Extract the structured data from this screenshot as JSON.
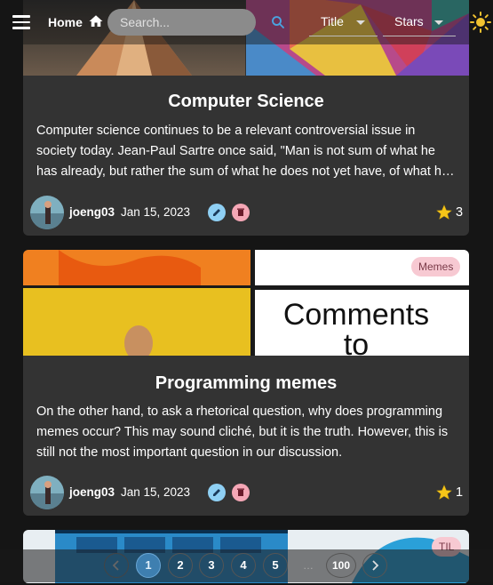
{
  "header": {
    "home_label": "Home",
    "search_placeholder": "Search...",
    "sort_select": "Title",
    "filter_select": "Stars"
  },
  "cards": [
    {
      "title": "Computer Science",
      "excerpt": "Computer science continues to be a relevant controversial issue in society today. Jean-Paul Sartre once said, \"Man is not sum of what he has already, but rather the sum of what he does not yet have, of what he could have.\"",
      "author": "joeng03",
      "date": "Jan 15, 2023",
      "stars": "3",
      "tag": ""
    },
    {
      "title": "Programming memes",
      "excerpt": "On the other hand, to ask a rhetorical question, why does programming memes occur? This may sound cliché, but it is the truth. However, this is still not the most important question in our discussion.",
      "author": "joeng03",
      "date": "Jan 15, 2023",
      "stars": "1",
      "tag": "Memes",
      "image_text_1": "Comments",
      "image_text_2": "to"
    },
    {
      "tag": "TIL"
    }
  ],
  "pagination": {
    "pages": [
      "1",
      "2",
      "3",
      "4",
      "5"
    ],
    "ellipsis": "…",
    "last": "100"
  },
  "colors": {
    "card_bg": "#333333",
    "active_page": "#3e7fb0",
    "tag_bg": "#f7c9d2",
    "edit": "#8fd0f4",
    "delete": "#f5a7b6",
    "star": "#f5c518"
  }
}
